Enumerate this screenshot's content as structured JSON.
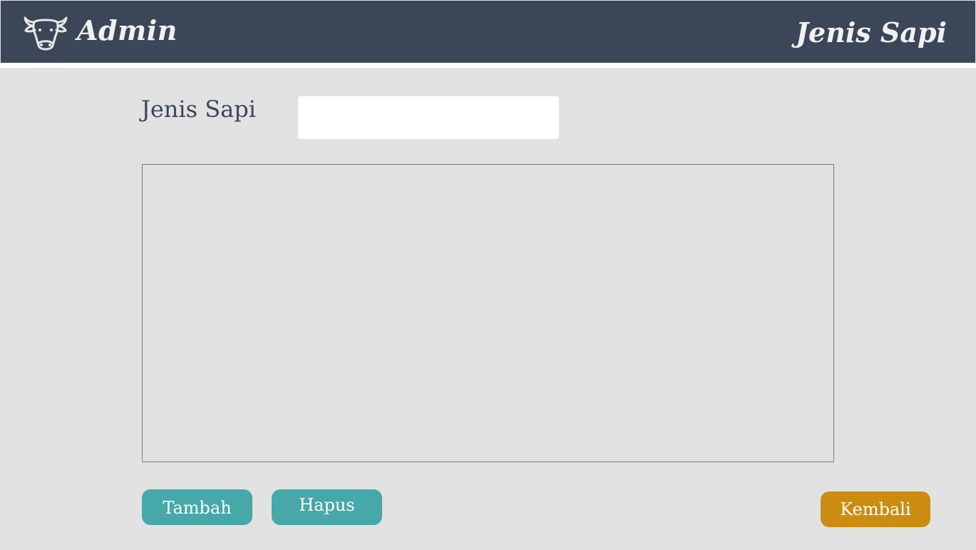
{
  "header": {
    "logo_icon": "cow-head-icon",
    "app_title": "Admin",
    "page_title": "Jenis Sapi",
    "background_color": "#3b4658"
  },
  "form": {
    "field_label": "Jenis Sapi",
    "field_value": "",
    "field_placeholder": ""
  },
  "list": {
    "items": []
  },
  "actions": {
    "add_label": "Tambah",
    "delete_label": "Hapus",
    "back_label": "Kembali",
    "primary_color": "#46a8a9",
    "back_color": "#cc8c0f"
  }
}
